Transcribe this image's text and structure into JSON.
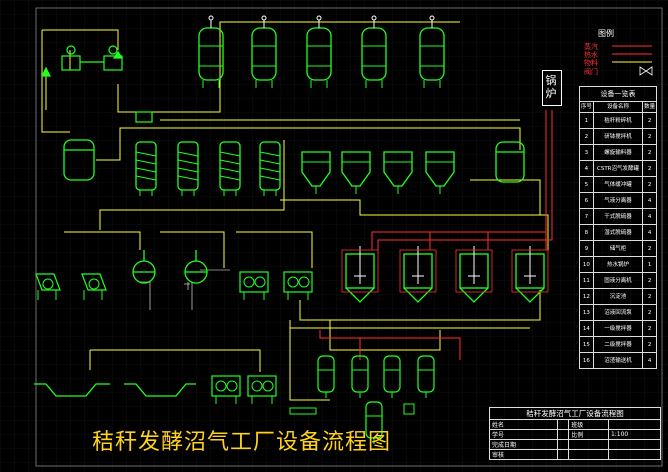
{
  "title": "秸秆发酵沼气工厂设备流程图",
  "legend": {
    "title": "图例",
    "items": [
      {
        "label": "蒸汽",
        "color": "#ff3030"
      },
      {
        "label": "热水",
        "color": "#ff3030"
      },
      {
        "label": "物料",
        "color": "#ffff33"
      },
      {
        "label": "阀门",
        "color": "#ffffff"
      }
    ]
  },
  "boiler_label": "锅炉",
  "equipment_table": {
    "caption": "设备一览表",
    "headers": [
      "序号",
      "设备名称",
      "数量"
    ],
    "rows": [
      [
        "1",
        "秸秆粉碎机",
        "2"
      ],
      [
        "2",
        "研钵搅拌机",
        "2"
      ],
      [
        "3",
        "螺旋输料器",
        "2"
      ],
      [
        "4",
        "CSTR沼气发酵罐",
        "2"
      ],
      [
        "5",
        "气体缓冲罐",
        "2"
      ],
      [
        "6",
        "气液分离器",
        "4"
      ],
      [
        "7",
        "干式脱硫器",
        "4"
      ],
      [
        "8",
        "湿式脱硫器",
        "4"
      ],
      [
        "9",
        "储气柜",
        "2"
      ],
      [
        "10",
        "热水锅炉",
        "1"
      ],
      [
        "11",
        "固液分离机",
        "2"
      ],
      [
        "12",
        "沉淀池",
        "2"
      ],
      [
        "13",
        "沼液回流泵",
        "2"
      ],
      [
        "14",
        "一级搅拌器",
        "2"
      ],
      [
        "15",
        "二级搅拌器",
        "2"
      ],
      [
        "16",
        "沼渣输送机",
        "4"
      ]
    ]
  },
  "title_block": {
    "drawing_name": "秸秆发酵沼气工厂设备流程图",
    "labels": [
      "姓名",
      "学号",
      "完成日期",
      "审核"
    ],
    "class_label": "班级",
    "scale_label": "比例",
    "scale_value": "1:100"
  },
  "colors": {
    "background": "#000000",
    "equipment": "#22ff22",
    "material_line": "#ffff33",
    "steam_line": "#ff3030",
    "text": "#ffffff",
    "title": "#ffd21f"
  }
}
